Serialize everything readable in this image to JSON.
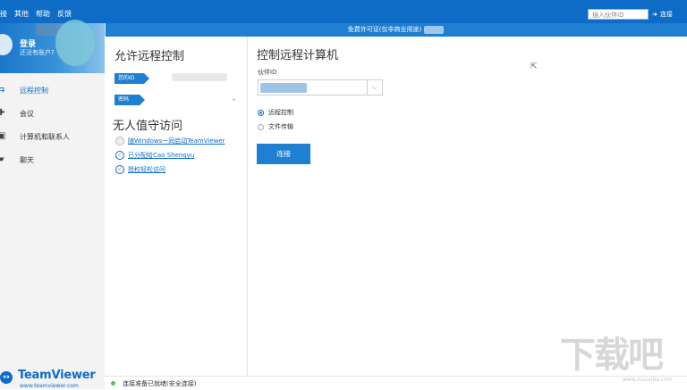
{
  "menubar": {
    "items": [
      "接",
      "其他",
      "帮助",
      "反馈"
    ],
    "partner_input_placeholder": "插入伙伴ID",
    "connect_mini_label": "连接"
  },
  "license_bar": {
    "text": "免费许可证(仅非商业用途)"
  },
  "profile": {
    "login": "登录",
    "no_account": "还没有账户?"
  },
  "nav": [
    {
      "label": "远程控制",
      "icon": "arrows-icon",
      "active": true
    },
    {
      "label": "会议",
      "icon": "meeting-icon",
      "active": false
    },
    {
      "label": "计算机和联系人",
      "icon": "contacts-icon",
      "active": false
    },
    {
      "label": "聊天",
      "icon": "chat-icon",
      "active": false
    }
  ],
  "brand": {
    "name": "TeamViewer",
    "url": "www.teamviewer.com"
  },
  "allow_panel": {
    "title": "允许远程控制",
    "your_id_label": "您的ID",
    "password_label": "密码",
    "password_value": "-",
    "unattended_title": "无人值守访问",
    "items": [
      {
        "text": "随Windows一同启动TeamViewer",
        "checked": false,
        "link": true
      },
      {
        "text": "已分配给Cao Shengyu",
        "checked": true,
        "link": false
      },
      {
        "text": "授权轻松访问",
        "checked": true,
        "link": false
      }
    ]
  },
  "control_panel": {
    "title": "控制远程计算机",
    "partner_id_label": "伙伴ID",
    "options": [
      {
        "label": "远程控制",
        "selected": true
      },
      {
        "label": "文件传输",
        "selected": false
      }
    ],
    "connect_label": "连接"
  },
  "status": {
    "text": "连接准备已就绪(安全连接)",
    "color": "#5cb85c"
  },
  "watermark": {
    "text": "下载吧",
    "small": "www.xiazaiba.com"
  },
  "colors": {
    "accent": "#0e6cc7"
  }
}
